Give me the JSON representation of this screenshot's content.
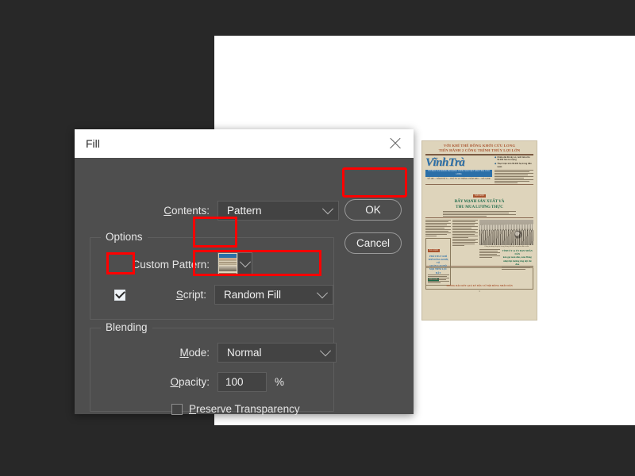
{
  "app": {
    "background_color": "#282828",
    "canvas_color": "#ffffff"
  },
  "dialog": {
    "title": "Fill",
    "close_icon": "close-icon",
    "contents": {
      "label": "Contents:",
      "label_mnemonic": "C",
      "value": "Pattern"
    },
    "options_group": {
      "title": "Options",
      "custom_pattern": {
        "label": "Custom Pattern:",
        "swatch_name": "newspaper-pattern-swatch",
        "chevron_icon": "chevron-down-icon"
      },
      "script": {
        "label": "Script:",
        "label_mnemonic": "S",
        "checked": true,
        "value": "Random Fill"
      }
    },
    "blending_group": {
      "title": "Blending",
      "mode": {
        "label": "Mode:",
        "label_mnemonic": "M",
        "value": "Normal"
      },
      "opacity": {
        "label": "Opacity:",
        "label_mnemonic": "O",
        "value": "100",
        "unit": "%"
      },
      "preserve_transparency": {
        "label": "Preserve Transparency",
        "label_mnemonic": "P",
        "checked": false
      }
    },
    "buttons": {
      "ok": "OK",
      "cancel": "Cancel"
    }
  },
  "annotations": {
    "color": "#ff0000",
    "boxes": [
      "ok-button-highlight",
      "custom-pattern-swatch-highlight",
      "script-checkbox-highlight",
      "script-dropdown-highlight"
    ]
  },
  "newspaper": {
    "headline_line1": "VỚI KHÍ THẾ ĐỒNG KHỞI CỬU LONG",
    "headline_line2": "TIẾN HÀNH 2 CÔNG TRÌNH THỦY LỢI LỚN",
    "masthead": "VĩnhTrà",
    "strap": "TỜ BÁO CỦA ĐẢNG BỘ ĐẢNG CỘNG SẢN VIỆT NAM TỈNH CỬU LONG",
    "dateline": "SỐ 180  —  NĂM THỨ 6  —  THỨ TƯ 21 THÁNG 1 NĂM 1981  —  GIÁ 0,20Đ",
    "bullets": [
      "Chiều dài 39 cây số, tưới tiêu cho 50.000 héc-ta ruộng",
      "Thực hiện trên 60.000 hạ trong đầu xuân"
    ],
    "kicker": "CỤC HỌC",
    "sub_line1": "ĐẨY MẠNH SẢN XUẤT VÀ",
    "sub_line2": "THU MUA LƯƠNG THỰC",
    "box_kicker": "XÃ LUẬN",
    "box_head_line1": "PHÁT HUY KHÍ THẾ ĐỒNG KHỞI, TỔ",
    "box_head_line2": "QUẢN CAO ĐỘ MỌI TIỀM LỰC ĐẤT",
    "photo_caption": "Công trường thủy lợi tưng bừng khí thế ra quân đầu xuân",
    "blurb_line1": "TỈNH ỦY và ỦY BAN NHÂN DÂN",
    "blurb_line2": "kêu gọi toàn dân, toàn Đảng",
    "blurb_line3": "nhiệt liệt hưởng ứng đợt thi đua",
    "footer_kicker": "TIN VẮN",
    "footer_line": "THÔNG BÁO KẾT QUẢ KỲ BẦU CỬ HỘI ĐỒNG NHÂN DÂN",
    "page_number": "1"
  }
}
